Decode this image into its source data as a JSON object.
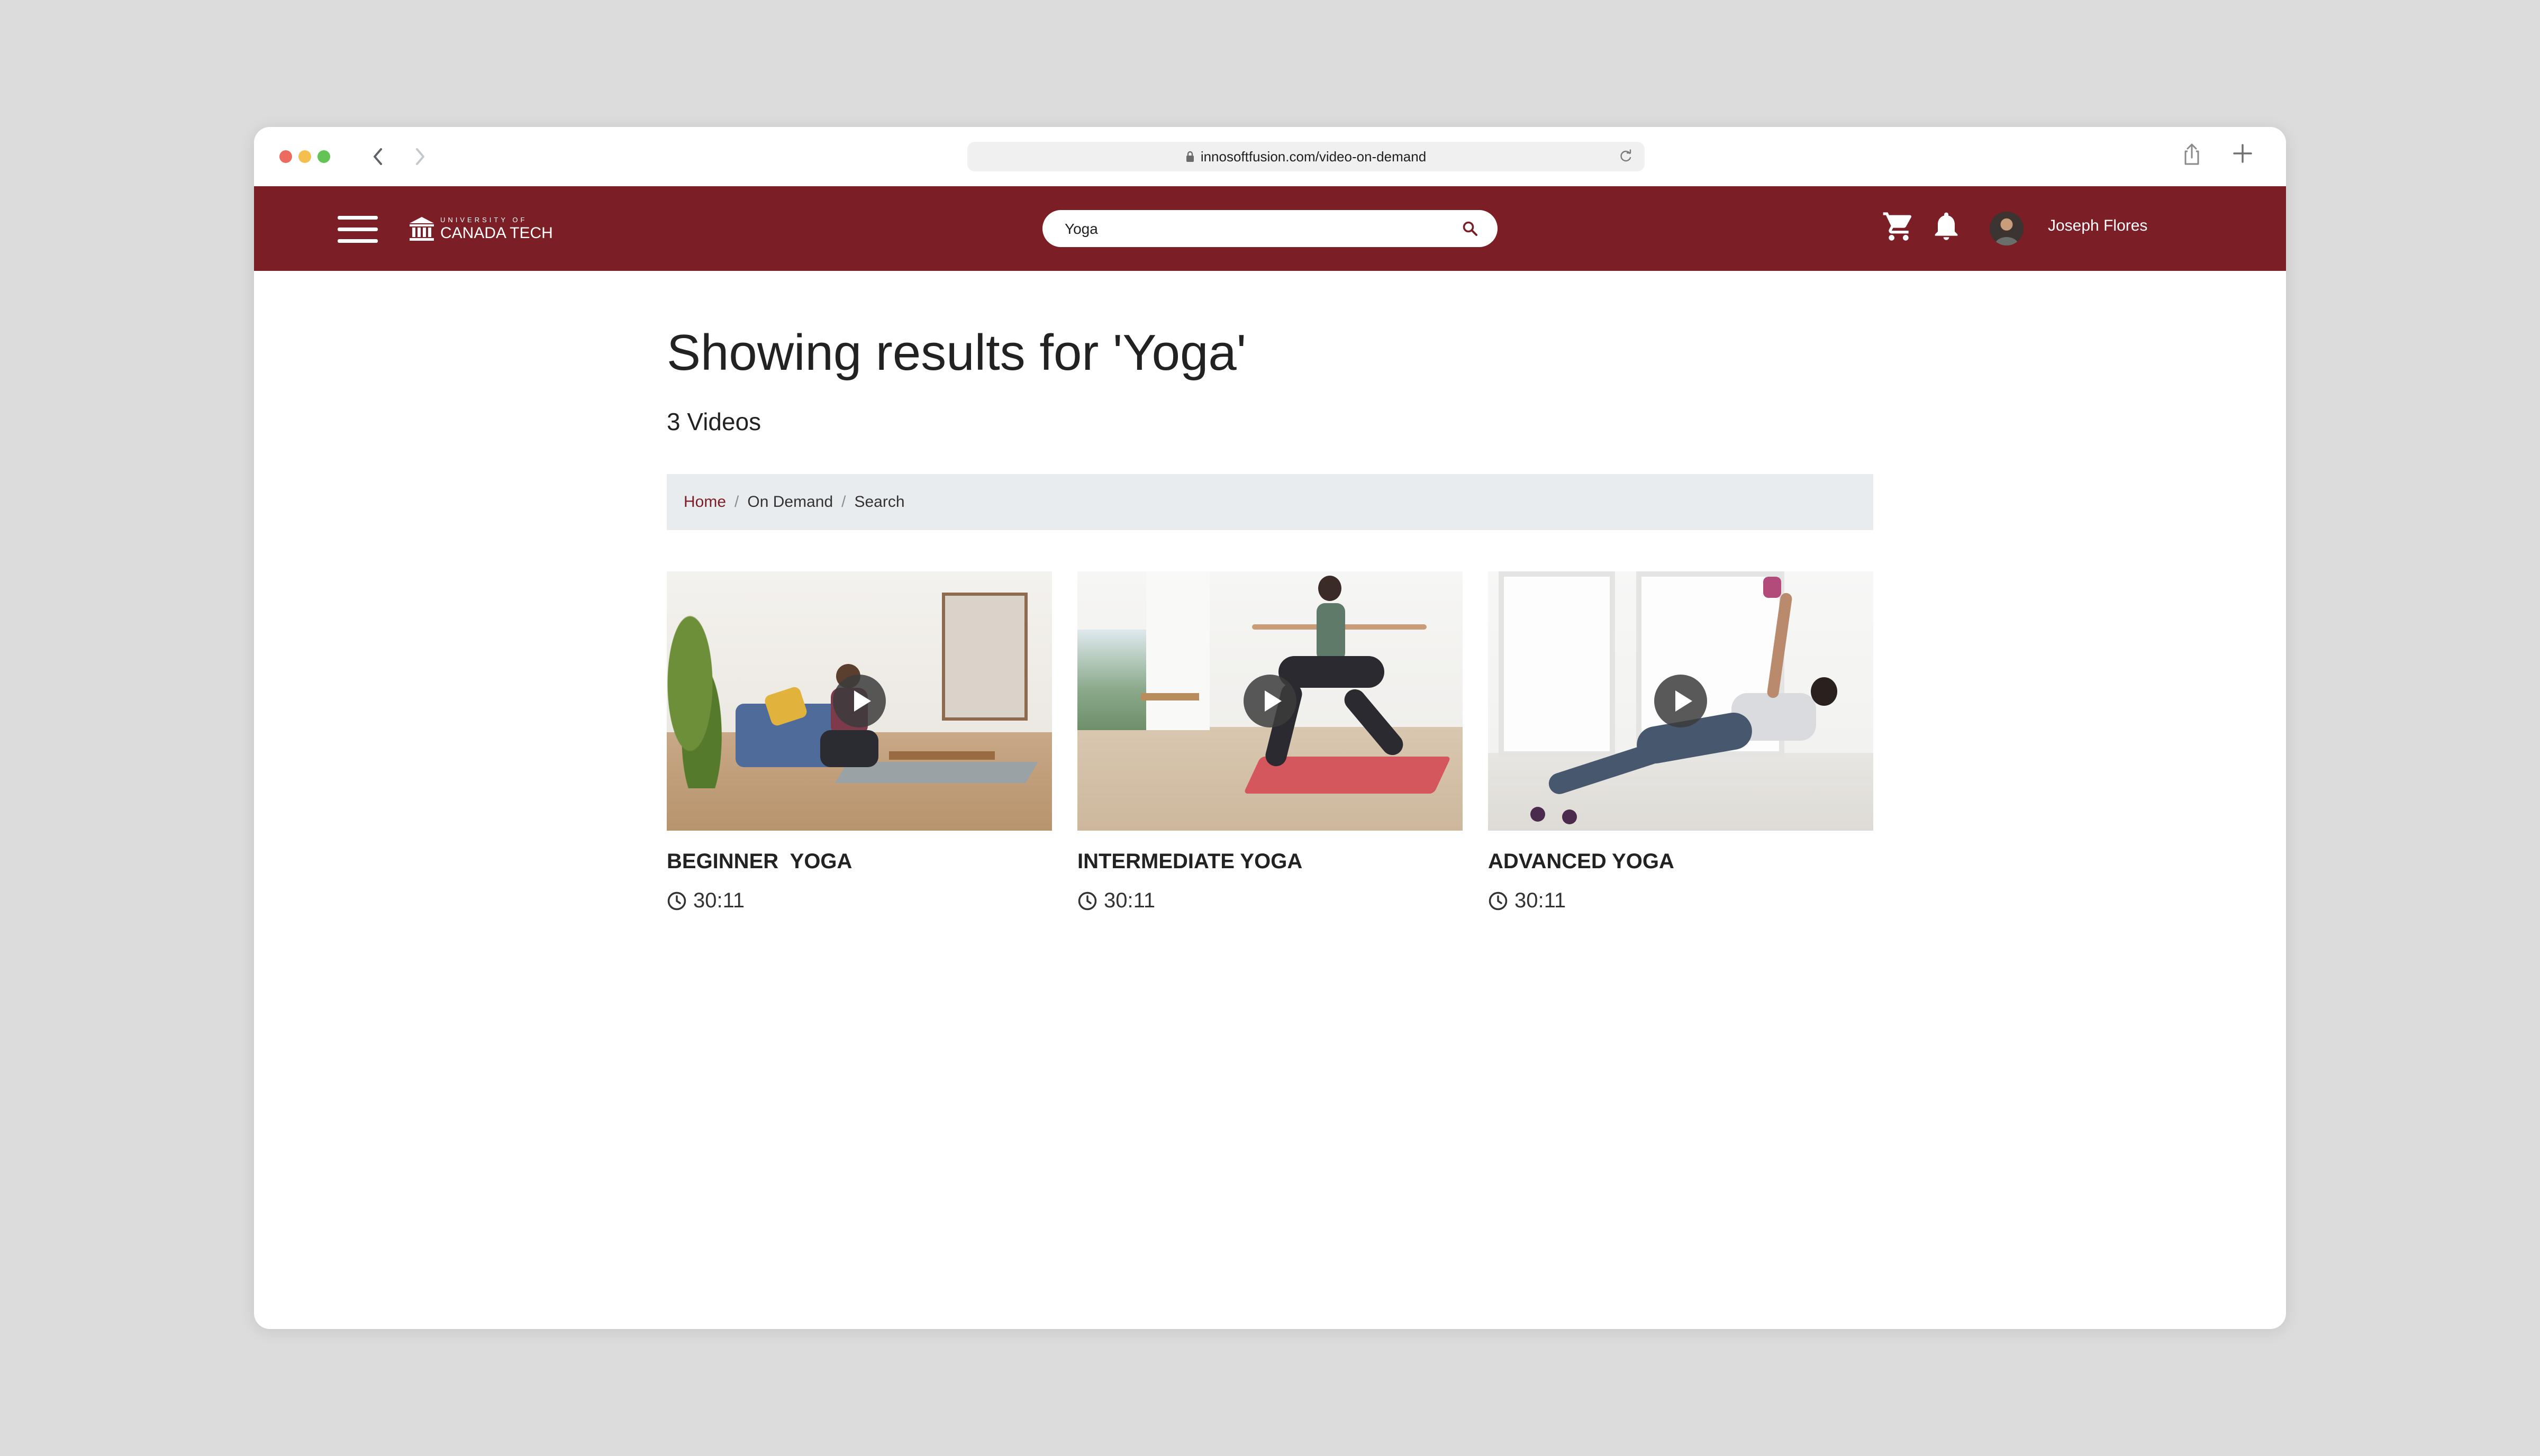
{
  "browser": {
    "url": "innosoftfusion.com/video-on-demand"
  },
  "header": {
    "logo": {
      "line1": "UNIVERSITY OF",
      "line2": "CANADA TECH"
    },
    "search": {
      "value": "Yoga"
    },
    "user_name": "Joseph Flores"
  },
  "main": {
    "title": "Showing results for 'Yoga'",
    "count": "3 Videos",
    "breadcrumb": [
      "Home",
      "On Demand",
      "Search"
    ],
    "breadcrumb_separator": "/",
    "videos": [
      {
        "title": "BEGINNER  YOGA",
        "duration": "30:11"
      },
      {
        "title": "INTERMEDIATE YOGA",
        "duration": "30:11"
      },
      {
        "title": "ADVANCED YOGA",
        "duration": "30:11"
      }
    ]
  },
  "colors": {
    "brand": "#7b1e26",
    "breadcrumb_bg": "#e9ecef",
    "page_bg": "#dcdcdc"
  },
  "icons": [
    "chevron-left-icon",
    "chevron-right-icon",
    "lock-icon",
    "reload-icon",
    "share-icon",
    "plus-icon",
    "menu-icon",
    "university-icon",
    "search-icon",
    "cart-icon",
    "bell-icon",
    "play-icon",
    "clock-icon"
  ]
}
